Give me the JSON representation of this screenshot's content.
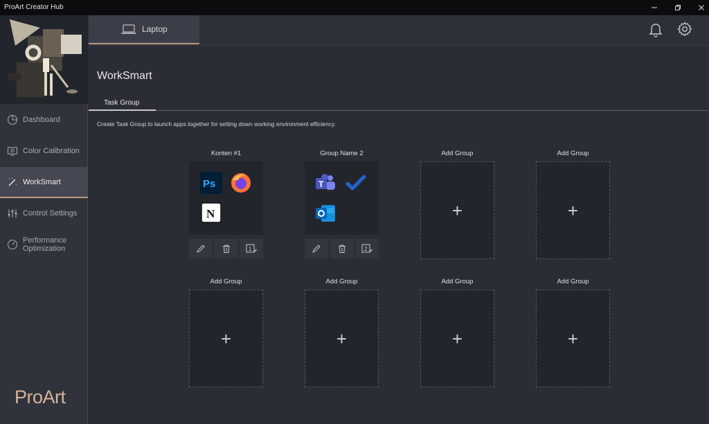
{
  "window": {
    "title": "ProArt Creator Hub"
  },
  "sidebar": {
    "items": [
      {
        "label": "Dashboard"
      },
      {
        "label": "Color Calibration"
      },
      {
        "label": "WorkSmart"
      },
      {
        "label": "Control Settings"
      },
      {
        "label": "Performance Optimization"
      }
    ],
    "brand": "ProArt"
  },
  "device_tab": {
    "label": "Laptop"
  },
  "page": {
    "title": "WorkSmart",
    "tab": "Task Group",
    "description": "Create Task Group to launch apps together for setting down working environment efficiency."
  },
  "groups": [
    {
      "label": "Konten #1",
      "apps": [
        "photoshop-icon",
        "firefox-icon",
        "notion-icon"
      ],
      "badge": "1"
    },
    {
      "label": "Group Name 2",
      "apps": [
        "teams-icon",
        "todo-icon",
        "outlook-icon"
      ],
      "badge": "2"
    },
    {
      "label": "Add Group"
    },
    {
      "label": "Add Group"
    },
    {
      "label": "Add Group"
    },
    {
      "label": "Add Group"
    },
    {
      "label": "Add Group"
    },
    {
      "label": "Add Group"
    }
  ],
  "colors": {
    "accent": "#b89b7e",
    "background": "#2a2d36",
    "card": "#23252c"
  }
}
